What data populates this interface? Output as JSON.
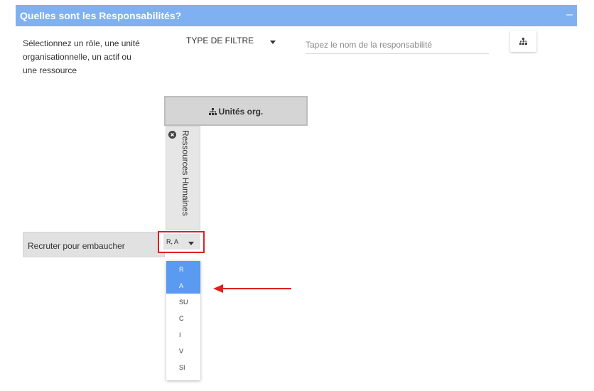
{
  "panel": {
    "title": "Quelles sont les Responsabilités?",
    "collapse_glyph": "–"
  },
  "filters": {
    "instructions": "Sélectionnez un rôle, une unité organisationnelle, un actif ou une ressource",
    "type_filter_label": "TYPE DE FILTRE",
    "search_placeholder": "Tapez le nom de la responsabilité",
    "org_button_icon": "sitemap-icon"
  },
  "matrix": {
    "header_icon": "sitemap-icon",
    "header_label": "Unités org.",
    "column_label": "Ressources Humaines",
    "remove_icon": "times-circle-icon",
    "row_label": "Recruter pour embaucher",
    "cell_value": "R, A",
    "dropdown_options": [
      {
        "label": "R",
        "selected": true
      },
      {
        "label": "A",
        "selected": true
      },
      {
        "label": "SU",
        "selected": false
      },
      {
        "label": "C",
        "selected": false
      },
      {
        "label": "I",
        "selected": false
      },
      {
        "label": "V",
        "selected": false
      },
      {
        "label": "SI",
        "selected": false
      }
    ]
  },
  "colors": {
    "header_bg": "#7fb0f2",
    "selected_option": "#5a9af0",
    "highlight": "#e02020"
  }
}
